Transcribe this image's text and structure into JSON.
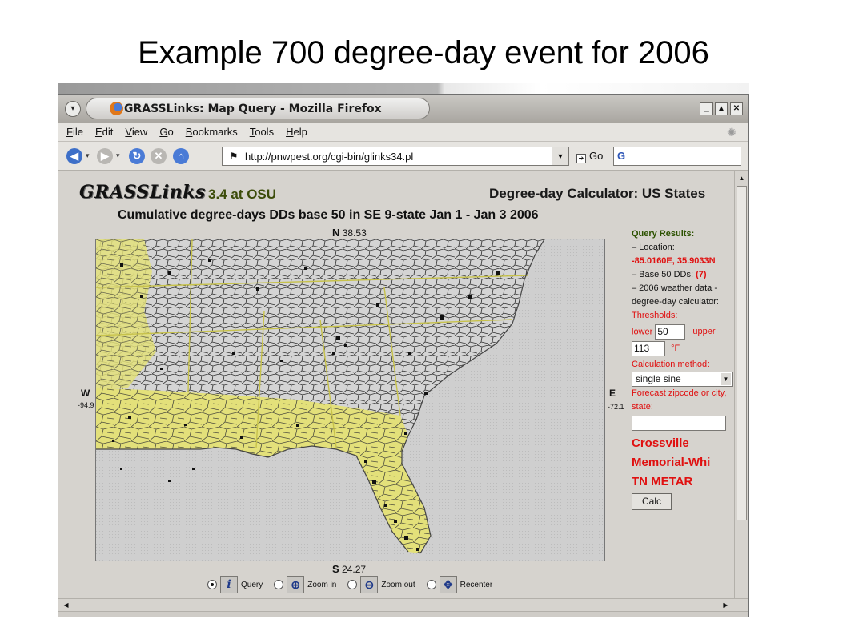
{
  "slide": {
    "title": "Example 700 degree-day event for 2006"
  },
  "window": {
    "title": "GRASSLinks: Map Query - Mozilla Firefox",
    "controls": {
      "menu": "▾",
      "minimize": "_",
      "maximize": "▲",
      "close": "✕"
    }
  },
  "menu": {
    "items": [
      "File",
      "Edit",
      "View",
      "Go",
      "Bookmarks",
      "Tools",
      "Help"
    ]
  },
  "nav": {
    "back_icon": "back-arrow-icon",
    "forward_icon": "forward-arrow-icon",
    "reload_icon": "reload-icon",
    "stop_icon": "stop-icon",
    "home_icon": "home-icon",
    "url": "http://pnwpest.org/cgi-bin/glinks34.pl",
    "go_label": "Go",
    "search_value": "G"
  },
  "page": {
    "logo": "GRASSLinks",
    "version": "3.4 at OSU",
    "app_title": "Degree-day Calculator: US States",
    "map_title": "Cumulative degree-days DDs base 50 in SE 9-state Jan 1 - Jan 3 2006",
    "coords": {
      "north_label": "N",
      "north_value": "38.53",
      "south_label": "S",
      "south_value": "24.27",
      "west_label": "W",
      "west_value": "-94.9",
      "east_label": "E",
      "east_value": "-72.1"
    },
    "tools": [
      {
        "label": "Query",
        "icon": "info-icon",
        "selected": true
      },
      {
        "label": "Zoom in",
        "icon": "zoom-in-icon",
        "selected": false
      },
      {
        "label": "Zoom out",
        "icon": "zoom-out-icon",
        "selected": false
      },
      {
        "label": "Recenter",
        "icon": "recenter-icon",
        "selected": false
      }
    ]
  },
  "results": {
    "heading": "Query Results:",
    "location_label": "– Location:",
    "location_value": "-85.0160E, 35.9033N",
    "base_label": "– Base 50 DDs:",
    "base_value": "(7)",
    "weather_label": "– 2006 weather data - degree-day calculator:",
    "thresholds_label": "Thresholds:",
    "lower_label": "lower",
    "lower_value": "50",
    "upper_label": "upper",
    "upper_value": "113",
    "unit": "°F",
    "method_label": "Calculation method:",
    "method_value": "single sine",
    "forecast_label": "Forecast zipcode or city, state:",
    "forecast_value": "",
    "station_line1": "Crossville",
    "station_line2": "Memorial-Whi",
    "station_line3": "TN METAR",
    "calc_button": "Calc"
  },
  "colors": {
    "map_fill": "#e3e07a",
    "county_lines": "#3a3a3a",
    "ocean": "#cdcdcd",
    "result_red": "#e01010",
    "result_green": "#2c5200"
  }
}
